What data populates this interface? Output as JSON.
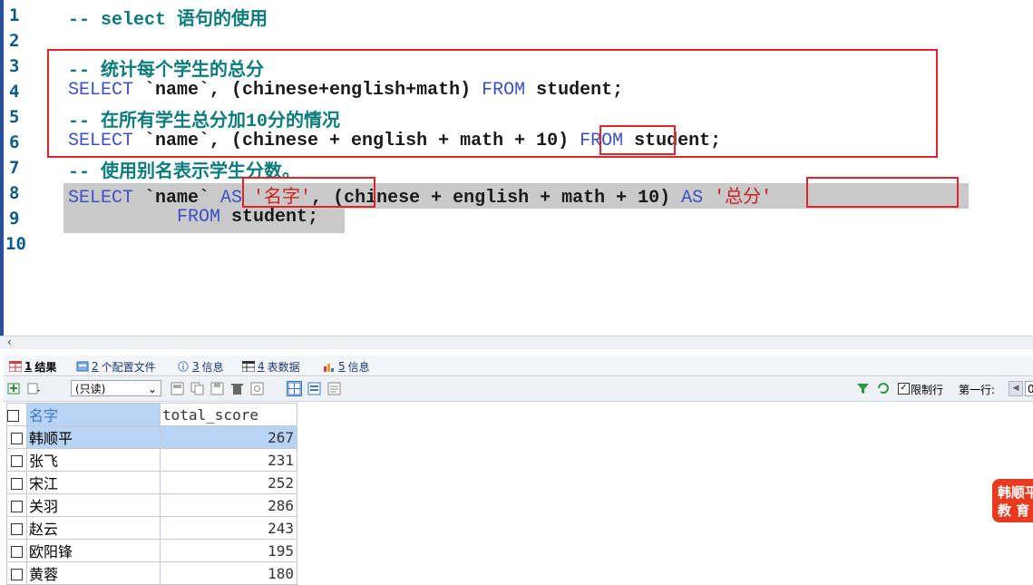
{
  "editor": {
    "line_numbers": [
      "1",
      "2",
      "3",
      "4",
      "5",
      "6",
      "7",
      "8",
      "9",
      "10"
    ],
    "line1_comment": "-- select 语句的使用",
    "line3_comment": "-- 统计每个学生的总分",
    "line4": {
      "kw1": "SELECT",
      "mid": " `name`, (chinese+english+math) ",
      "kw2": "FROM",
      "end": " student;"
    },
    "line5_comment": "-- 在所有学生总分加10分的情况",
    "line6": {
      "kw1": "SELECT",
      "mid": " `name`, (chinese + english + math + 10) ",
      "kw2": "FROM",
      "end": " student;"
    },
    "line7_comment": "-- 使用别名表示学生分数。",
    "line8": {
      "kw1": "SELECT",
      "p1": " `name` ",
      "kw2": "AS",
      "s1": " '名字'",
      "p2": ", (chinese + english + math + 10) ",
      "kw3": "AS",
      "s2": " '总分'"
    },
    "line9": {
      "indent": "          ",
      "kw1": "FROM",
      "end": " student;"
    }
  },
  "tabs": [
    {
      "num": "1",
      "label": "结果"
    },
    {
      "num": "2",
      "label": "个配置文件"
    },
    {
      "num": "3",
      "label": "信息"
    },
    {
      "num": "4",
      "label": "表数据"
    },
    {
      "num": "5",
      "label": "信息"
    }
  ],
  "toolbar": {
    "readonly_select": "(只读)",
    "limit_rows_label": "限制行",
    "first_row_label": "第一行:",
    "first_row_value": "0"
  },
  "results": {
    "columns": [
      "名字",
      "total_score"
    ],
    "rows": [
      {
        "name": "韩顺平",
        "score": "267"
      },
      {
        "name": "张飞",
        "score": "231"
      },
      {
        "name": "宋江",
        "score": "252"
      },
      {
        "name": "关羽",
        "score": "286"
      },
      {
        "name": "赵云",
        "score": "243"
      },
      {
        "name": "欧阳锋",
        "score": "195"
      },
      {
        "name": "黄蓉",
        "score": "180"
      }
    ]
  },
  "badge": {
    "line1": "韩顺平",
    "line2": "教 育"
  },
  "colors": {
    "comment": "#0b7b7b",
    "keyword": "#3b50c8",
    "string": "#cc2020",
    "highlight_box": "#e0242a",
    "selected_cell": "#b8d4f5"
  }
}
